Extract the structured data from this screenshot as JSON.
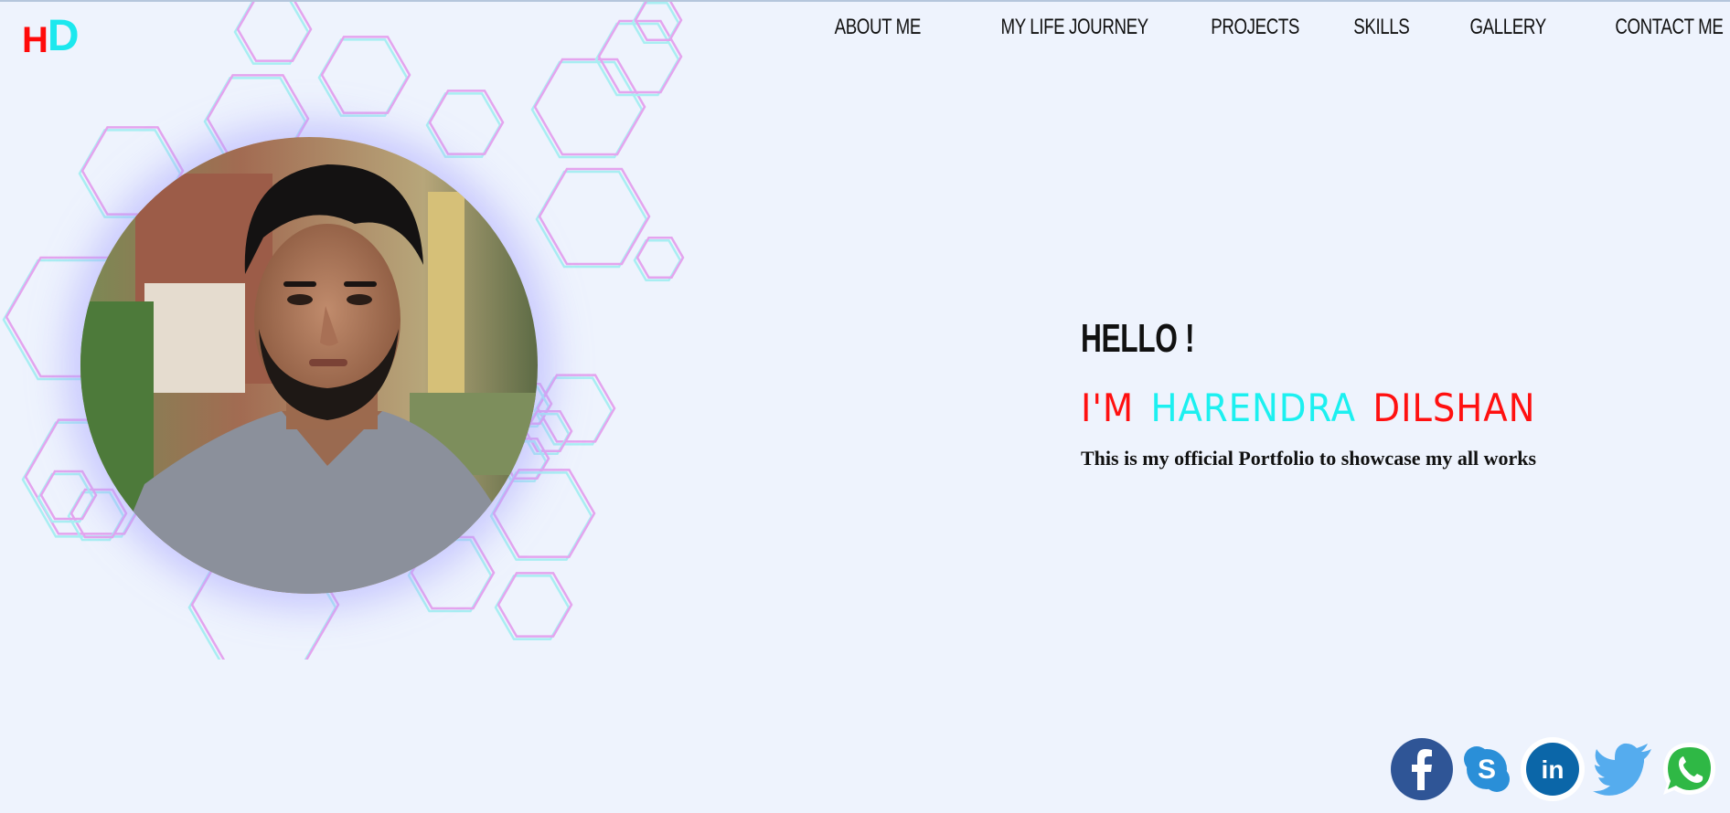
{
  "logo": {
    "h": "H",
    "d": "D"
  },
  "nav": {
    "items": [
      "ABOUT ME",
      "MY LIFE JOURNEY",
      "PROJECTS",
      "SKILLS",
      "GALLERY",
      "CONTACT ME"
    ]
  },
  "hero": {
    "greeting": "HELLO !",
    "name_prefix": "I'M",
    "first_name": "HARENDRA",
    "last_name": "DILSHAN",
    "description": "This is my official Portfolio to showcase my all works"
  },
  "social": [
    "facebook-icon",
    "skype-icon",
    "linkedin-icon",
    "twitter-icon",
    "whatsapp-icon"
  ],
  "colors": {
    "background": "#eef3fd",
    "accent_red": "#ff1010",
    "accent_cyan": "#1cf0f0",
    "hex_pink": "#e4a4ee",
    "hex_cyan": "#a8eef2"
  }
}
